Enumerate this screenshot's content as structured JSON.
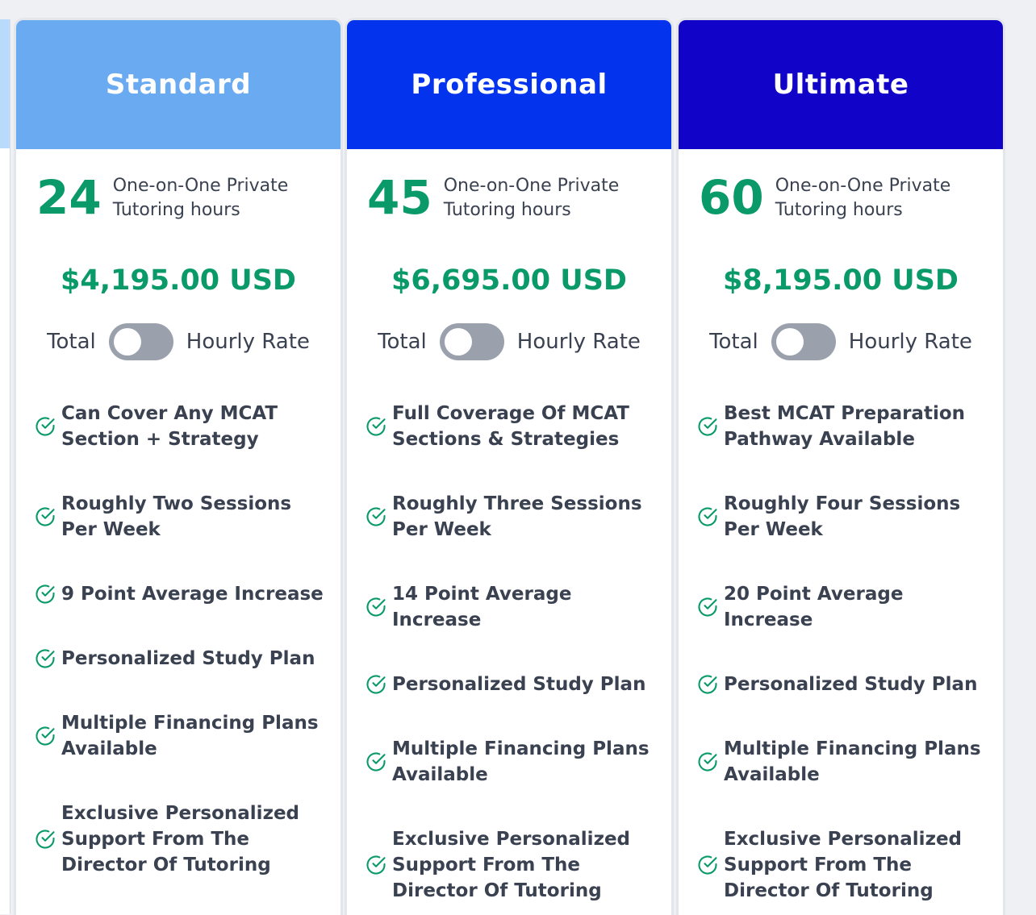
{
  "colors": {
    "accent_green": "#0a9a6a",
    "standard_header": "#6aaaf0",
    "professional_header": "#0433ee",
    "ultimate_header": "#1104c8",
    "text_dark": "#3a4150",
    "toggle_off": "#9aa1ad"
  },
  "plans": [
    {
      "name": "Standard",
      "hours": "24",
      "hours_label": "One-on-One Private Tutoring hours",
      "price": "$4,195.00 USD",
      "toggle_left": "Total",
      "toggle_right": "Hourly Rate",
      "features": [
        "Can Cover Any MCAT Section + Strategy",
        "Roughly Two Sessions Per Week",
        "9 Point Average Increase",
        "Personalized Study Plan",
        "Multiple Financing Plans Available",
        "Exclusive Personalized Support From The Director Of Tutoring"
      ]
    },
    {
      "name": "Professional",
      "hours": "45",
      "hours_label": "One-on-One Private Tutoring hours",
      "price": "$6,695.00 USD",
      "toggle_left": "Total",
      "toggle_right": "Hourly Rate",
      "features": [
        "Full Coverage Of MCAT Sections & Strategies",
        "Roughly Three Sessions Per Week",
        "14 Point Average Increase",
        "Personalized Study Plan",
        "Multiple Financing Plans Available",
        "Exclusive Personalized Support From The Director Of Tutoring"
      ]
    },
    {
      "name": "Ultimate",
      "hours": "60",
      "hours_label": "One-on-One Private Tutoring hours",
      "price": "$8,195.00 USD",
      "toggle_left": "Total",
      "toggle_right": "Hourly Rate",
      "features": [
        "Best MCAT Preparation Pathway Available",
        "Roughly Four Sessions Per Week",
        "20 Point Average Increase",
        "Personalized Study Plan",
        "Multiple Financing Plans Available",
        "Exclusive Personalized Support From The Director Of Tutoring"
      ]
    }
  ]
}
